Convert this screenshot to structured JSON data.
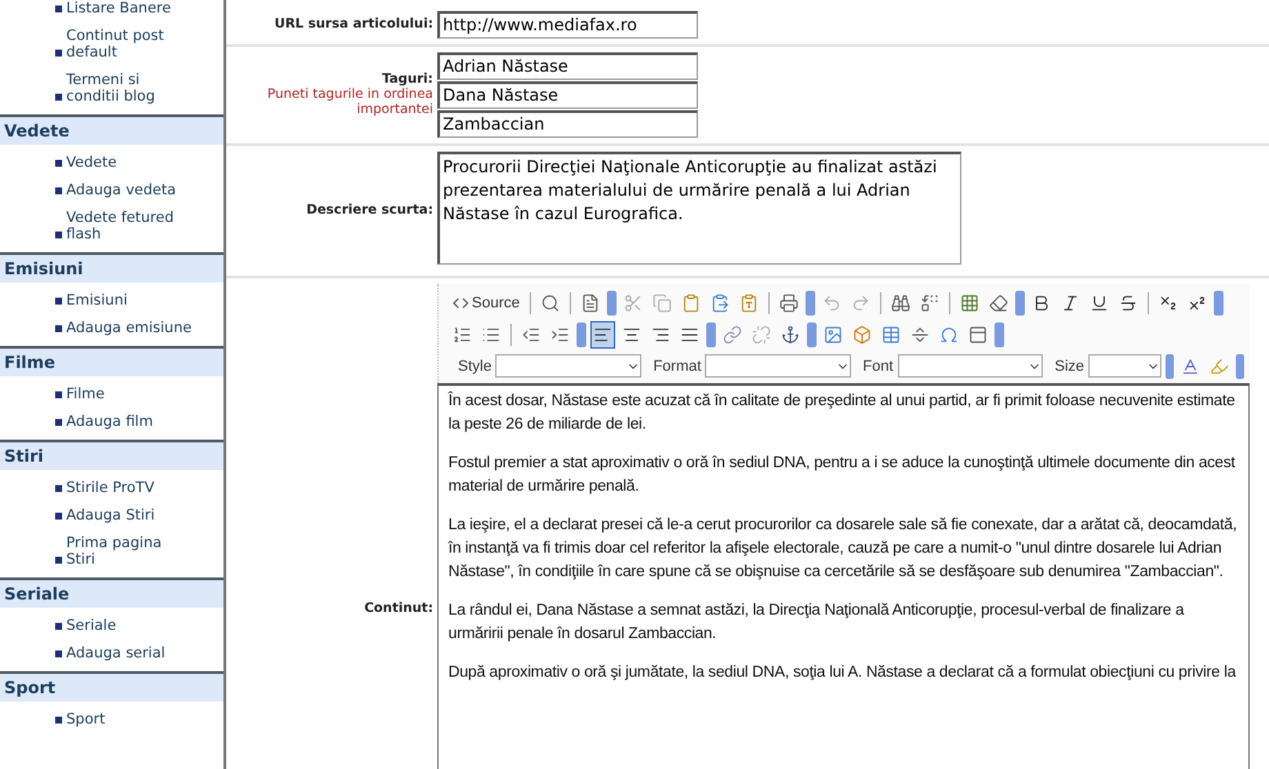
{
  "sidebar": {
    "groups": [
      {
        "items": [
          "Listare Banere",
          "Continut post default",
          "Termeni si conditii blog"
        ]
      },
      {
        "title": "Vedete",
        "items": [
          "Vedete",
          "Adauga vedeta",
          "Vedete fetured flash"
        ]
      },
      {
        "title": "Emisiuni",
        "items": [
          "Emisiuni",
          "Adauga emisiune"
        ]
      },
      {
        "title": "Filme",
        "items": [
          "Filme",
          "Adauga film"
        ]
      },
      {
        "title": "Stiri",
        "items": [
          "Stirile ProTV",
          "Adauga Stiri",
          "Prima pagina Stiri"
        ]
      },
      {
        "title": "Seriale",
        "items": [
          "Seriale",
          "Adauga serial"
        ]
      },
      {
        "title": "Sport",
        "items": [
          "Sport"
        ]
      }
    ]
  },
  "form": {
    "url": {
      "label": "URL sursa articolului:",
      "value": "http://www.mediafax.ro"
    },
    "tags": {
      "label": "Taguri:",
      "hint": "Puneti tagurile in ordinea importantei",
      "values": [
        "Adrian Năstase",
        "Dana Năstase",
        "Zambaccian"
      ]
    },
    "description": {
      "label": "Descriere scurta:",
      "value": "Procurorii Direcţiei Naţionale Anticorupţie au finalizat astăzi prezentarea materialului de urmărire penală a lui Adrian Năstase în cazul Eurografica."
    },
    "content": {
      "label": "Continut:",
      "toolbar": {
        "source_label": "Source",
        "alignment": [
          {
            "selected": true
          },
          {
            "selected": false
          },
          {
            "selected": false
          },
          {
            "selected": false
          }
        ],
        "combos": [
          {
            "label": "Style"
          },
          {
            "label": "Format"
          },
          {
            "label": "Font"
          },
          {
            "label": "Size"
          }
        ]
      },
      "paragraphs": [
        "În acest dosar, Năstase este acuzat că în calitate de preşedinte al unui partid, ar fi primit foloase necuvenite estimate la peste 26 de miliarde de lei.",
        "Fostul premier a stat aproximativ o oră în sediul DNA, pentru a i se aduce la cunoştinţă ultimele documente din acest material de urmărire penală.",
        "La ieşire, el a declarat presei că le-a cerut procurorilor ca dosarele sale să fie conexate, dar a arătat că, deocamdată, în instanţă va fi trimis doar cel referitor la afişele electorale, cauză pe care a numit-o \"unul dintre dosarele lui Adrian Năstase\", în condiţiile în care spune că se obişnuise ca cercetările să se desfăşoare sub denumirea \"Zambaccian\".",
        "La rândul ei, Dana Năstase a semnat astăzi, la Direcţia Naţională Anticorupţie, procesul-verbal de finalizare a urmăririi penale în dosarul Zambaccian.",
        "După aproximativ o oră şi jumătate, la sediul DNA, soţia lui A. Năstase a declarat că a formulat obiecţiuni cu privire la"
      ]
    }
  }
}
